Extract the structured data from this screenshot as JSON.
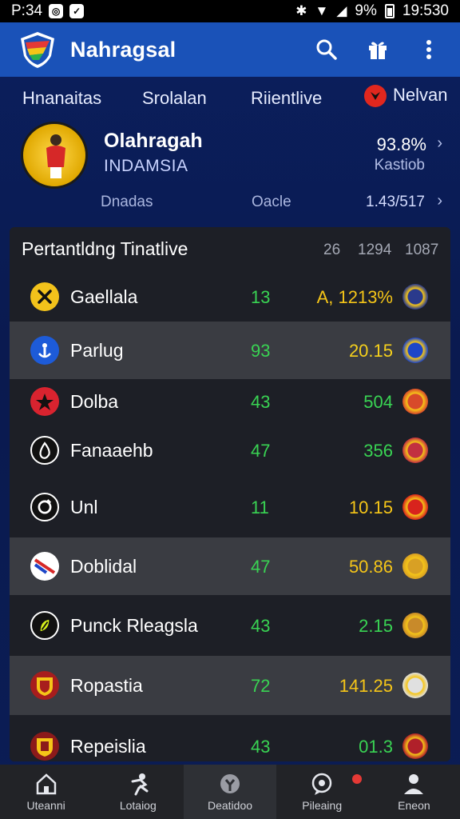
{
  "status_bar": {
    "time_left": "P:34",
    "battery": "9%",
    "clock": "19:530"
  },
  "app": {
    "title": "Nahragsal"
  },
  "tabs": [
    {
      "label": "Hnanaitas"
    },
    {
      "label": "Srolalan"
    },
    {
      "label": "Riientlive"
    },
    {
      "label": "Nelvan"
    }
  ],
  "profile": {
    "name": "Olahragah",
    "country": "INDAMSIA",
    "stat": "93.8%",
    "sub": "Kastiob",
    "mini_left": "Dnadas",
    "mini_mid": "Oacle",
    "mini_right": "1.43/517"
  },
  "table": {
    "title": "Pertantldng Tinatlive",
    "headers": [
      "26",
      "1294",
      "1087"
    ],
    "rows": [
      {
        "name": "Gaellala",
        "a": "13",
        "b": "A, 1213%",
        "b_color": "#f5c518",
        "icon": "x-icon",
        "icon_bg": "#f2c21b",
        "crest_bg": "#2a3a8c"
      },
      {
        "name": "Parlug",
        "a": "93",
        "b": "20.15",
        "b_color": "#f5d01c",
        "icon": "anchor-icon",
        "icon_bg": "#1d5bd8",
        "crest_bg": "#1d46c8"
      },
      {
        "name": "Dolba",
        "a": "43",
        "b": "504",
        "b_color": "#39d353",
        "icon": "star-icon",
        "icon_bg": "#d9232f",
        "crest_bg": "#d84a2a"
      },
      {
        "name": "Fanaaehb",
        "a": "47",
        "b": "356",
        "b_color": "#39d353",
        "icon": "drop-icon",
        "icon_bg": "#111111",
        "crest_bg": "#c23040"
      },
      {
        "name": "Unl",
        "a": "11",
        "b": "10.15",
        "b_color": "#f5c518",
        "icon": "cycle-icon",
        "icon_bg": "#111111",
        "crest_bg": "#d8231d"
      },
      {
        "name": "Doblidal",
        "a": "47",
        "b": "50.86",
        "b_color": "#f5c518",
        "icon": "flag-icon",
        "icon_bg": "#ffffff",
        "crest_bg": "#d8a024"
      },
      {
        "name": "Punck Rleagsla",
        "a": "43",
        "b": "2.15",
        "b_color": "#39d353",
        "icon": "leaf-icon",
        "icon_bg": "#111111",
        "crest_bg": "#c88a2a"
      },
      {
        "name": "Ropastia",
        "a": "72",
        "b": "141.25",
        "b_color": "#f5c518",
        "icon": "shield-icon",
        "icon_bg": "#a71d1d",
        "crest_bg": "#e0e0e0"
      },
      {
        "name": "Repeislia",
        "a": "43",
        "b": "01.3",
        "b_color": "#39d353",
        "icon": "crest-icon",
        "icon_bg": "#8b1a1a",
        "crest_bg": "#b0202a"
      }
    ]
  },
  "bottom_nav": [
    {
      "label": "Uteanni",
      "icon": "home-icon"
    },
    {
      "label": "Lotaiog",
      "icon": "player-icon"
    },
    {
      "label": "Deatidoo",
      "icon": "ball-icon",
      "active": true
    },
    {
      "label": "Pileaing",
      "icon": "chat-icon"
    },
    {
      "label": "Eneon",
      "icon": "profile-icon"
    }
  ],
  "colors": {
    "appbar": "#1a52b8",
    "green": "#39d353",
    "yellow": "#f5c518"
  }
}
